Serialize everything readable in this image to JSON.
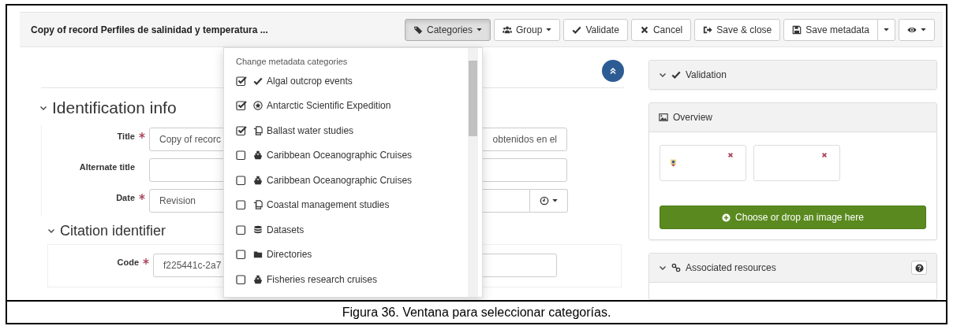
{
  "title": "Copy of record Perfiles de salinidad y temperatura ...",
  "toolbar": [
    {
      "label": "Categories",
      "kind": "dropdown",
      "selected": true
    },
    {
      "label": "Group",
      "kind": "dropdown",
      "selected": false
    },
    {
      "label": "Validate",
      "kind": "button",
      "selected": false
    },
    {
      "label": "Cancel",
      "kind": "button",
      "selected": false
    },
    {
      "label": "Save & close",
      "kind": "button",
      "selected": false
    },
    {
      "label": "Save metadata",
      "kind": "split",
      "selected": false
    },
    {
      "kind": "menu",
      "selected": false
    }
  ],
  "sections": [
    {
      "title": "Identification info",
      "expanded": true,
      "fields": [
        {
          "label": "Title",
          "required": true,
          "value_start": "Copy of recorc",
          "value_end": "obtenidos en el"
        },
        {
          "label": "Alternate title",
          "required": false
        },
        {
          "label": "Date",
          "required": true,
          "value_start": "Revision",
          "kind": "date"
        }
      ]
    },
    {
      "title": "Citation identifier",
      "expanded": true,
      "fields": [
        {
          "label": "Code",
          "required": true,
          "value_start": "f225441c-2a7"
        }
      ]
    }
  ],
  "categories": {
    "header": "Change metadata categories",
    "items": [
      {
        "label": "Algal outcrop events",
        "checked": true
      },
      {
        "label": "Antarctic Scientific Expedition",
        "checked": true
      },
      {
        "label": "Ballast water studies",
        "checked": true
      },
      {
        "label": "Caribbean Oceanographic Cruises",
        "checked": false
      },
      {
        "label": "Caribbean Oceanographic Cruises",
        "checked": false
      },
      {
        "label": "Coastal management studies",
        "checked": false
      },
      {
        "label": "Datasets",
        "checked": false
      },
      {
        "label": "Directories",
        "checked": false
      },
      {
        "label": "Fisheries research cruises",
        "checked": false
      }
    ]
  },
  "validation": {
    "title": "Validation"
  },
  "overview": {
    "title": "Overview",
    "thumbnails": [
      {
        "has_image": true
      },
      {
        "has_image": false
      }
    ],
    "upload_button": "Choose or drop an image here"
  },
  "associated": {
    "title": "Associated resources"
  },
  "caption": "Figura 36. Ventana para seleccionar categorías."
}
